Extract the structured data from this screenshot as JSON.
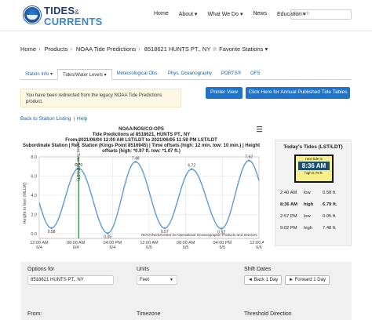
{
  "header": {
    "brand_line1": "TIDES",
    "brand_amp": "&",
    "brand_line2": "CURRENTS",
    "nav": [
      "Home",
      "About ▾",
      "What We Do ▾",
      "News",
      "Education ▾"
    ],
    "search_placeholder": "Search"
  },
  "breadcrumb": {
    "items": [
      "Home",
      "Products",
      "NOAA Tide Predictions"
    ],
    "station": "8518621 HUNTS PT., NY",
    "favorite_star": "☆",
    "favorites": "Favorite Stations ▾"
  },
  "tabs": [
    "Station Info ▾",
    "Tides/Water Levels ▾",
    "Meteorological Obs.",
    "Phys. Oceanography",
    "PORTS®",
    "OFS"
  ],
  "notice": {
    "text": "You have been redirected from the legacy NOAA Tide Predictions product."
  },
  "buttons": {
    "print": "Printer View",
    "annual": "Click Here for Annual Published Tide Tables"
  },
  "links": {
    "back": "Back to Station Listing",
    "sep": "|",
    "help": "Help"
  },
  "chart_data": {
    "type": "line",
    "title_lines": [
      "NOAA/NOS/CO-OPS",
      "Tide Predictions at 8518621, HUNTS PT., NY",
      "From 2021/06/04 12:00 AM LST/LDT to 2021/06/05 11:59 PM LST/LDT",
      "Subordinate Station | Ref. Station (Kings Point 8516945) | Time offsets (high: 12 min. low: 10 min.) | Height",
      "offsets (high: *0.97 ft. low: *1.07 ft.)"
    ],
    "ylabel": "Height in feet (MLLW)",
    "ylim": [
      -0.5,
      8.0
    ],
    "yticks": [
      0.0,
      2.0,
      4.0,
      6.0,
      8.0
    ],
    "x_hours": [
      0,
      48
    ],
    "xticks": [
      {
        "h": 0,
        "time": "12:00 AM",
        "date": "6/4"
      },
      {
        "h": 8,
        "time": "08:00 AM",
        "date": "6/4"
      },
      {
        "h": 16,
        "time": "04:00 PM",
        "date": "6/4"
      },
      {
        "h": 24,
        "time": "12:00 AM",
        "date": "6/5"
      },
      {
        "h": 32,
        "time": "08:00 AM",
        "date": "6/5"
      },
      {
        "h": 40,
        "time": "04:00 PM",
        "date": "6/5"
      },
      {
        "h": 48,
        "time": "12:00 AM",
        "date": "6/6"
      }
    ],
    "extrema": [
      {
        "h": 2.67,
        "v": 0.58,
        "label": "0.58"
      },
      {
        "h": 8.6,
        "v": 6.79,
        "label": "6.79"
      },
      {
        "h": 14.95,
        "v": 0.05,
        "label": "0.05"
      },
      {
        "h": 21.03,
        "v": 7.48,
        "label": "7.48"
      },
      {
        "h": 27.4,
        "v": 0.57,
        "label": "0.57"
      },
      {
        "h": 33.3,
        "v": 6.72,
        "label": "6.72"
      },
      {
        "h": 39.8,
        "v": 0.52,
        "label": "0.52"
      },
      {
        "h": 45.8,
        "v": 7.62,
        "label": "7.62"
      }
    ],
    "now_label": "Current Time (LST/LDT)",
    "now_h": 8.6,
    "grid": true,
    "series_color": "#5b9bd5",
    "credit": "NOAA/NOS/Center for Operational Oceanographic Products and Services"
  },
  "tides_panel": {
    "title": "Today's Tides (LST/LDT)",
    "clock_top": "next tide is",
    "clock_time": "8:36 AM",
    "clock_bottom": "high 6.79 ft.",
    "rows": [
      {
        "time": "2:40 AM",
        "type": "low",
        "height": "0.58 ft.",
        "now": false
      },
      {
        "time": "8:36 AM",
        "type": "high",
        "height": "6.79 ft.",
        "now": true
      },
      {
        "time": "2:57 PM",
        "type": "low",
        "height": "0.05 ft.",
        "now": false
      },
      {
        "time": "9:02 PM",
        "type": "high",
        "height": "7.48 ft.",
        "now": false
      }
    ]
  },
  "options": {
    "options_label": "Options for",
    "station_value": "8518621 HUNTS PT., NY",
    "from_label": "From:",
    "units_label": "Units",
    "units_value": "Feet",
    "timezone_label": "Timezone",
    "shift_label": "Shift Dates",
    "back_btn": "◄ Back 1 Day",
    "forward_btn": "► Forward 1 Day",
    "threshold_label": "Threshold Direction"
  }
}
